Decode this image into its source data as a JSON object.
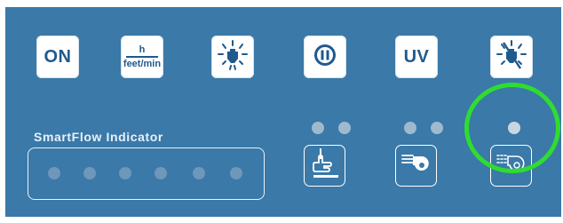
{
  "buttons": {
    "on_label": "ON",
    "units_top": "h",
    "units_bottom": "feet/min",
    "uv_label": "UV"
  },
  "indicator": {
    "label": "SmartFlow Indicator",
    "dot_count": 6
  },
  "colors": {
    "panel_blue": "#3a79a8",
    "button_white": "#ffffff",
    "button_text": "#1f5a8e",
    "highlight_green": "#2fdc2f"
  },
  "icons": {
    "light": "light-bulb-icon",
    "pause": "pause-icon",
    "light_off": "light-off-icon",
    "sash": "sash-hand-icon",
    "blower": "blower-icon",
    "blower_off": "blower-outline-icon"
  }
}
